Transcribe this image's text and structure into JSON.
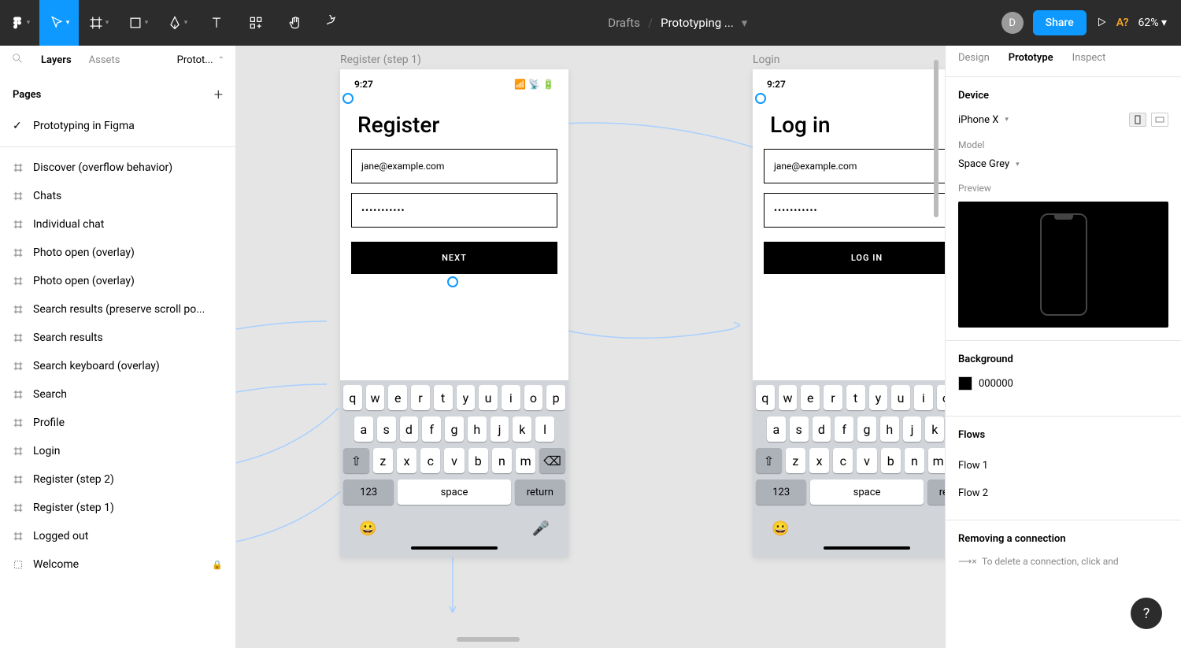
{
  "toolbar": {
    "breadcrumb_root": "Drafts",
    "breadcrumb_file": "Prototyping ...",
    "avatar_initial": "D",
    "share_label": "Share",
    "a11y_label": "A?",
    "zoom_label": "62%"
  },
  "left_panel": {
    "tab_layers": "Layers",
    "tab_assets": "Assets",
    "page_selector": "Protot...",
    "pages_header": "Pages",
    "page_name": "Prototyping in Figma",
    "layers": [
      "Discover (overflow behavior)",
      "Chats",
      "Individual chat",
      "Photo open (overlay)",
      "Photo open (overlay)",
      "Search results (preserve scroll po...",
      "Search results",
      "Search keyboard (overlay)",
      "Search",
      "Profile",
      "Login",
      "Register (step 2)",
      "Register (step 1)",
      "Logged out"
    ],
    "welcome_layer": "Welcome"
  },
  "canvas": {
    "frame1_label": "Register (step 1)",
    "frame2_label": "Login",
    "status_time": "9:27",
    "register_title": "Register",
    "login_title": "Log in",
    "email_placeholder": "jane@example.com",
    "password_dots": "•••••••••••",
    "next_button": "NEXT",
    "login_button": "LOG IN",
    "keyboard": {
      "row1": [
        "q",
        "w",
        "e",
        "r",
        "t",
        "y",
        "u",
        "i",
        "o",
        "p"
      ],
      "row2": [
        "a",
        "s",
        "d",
        "f",
        "g",
        "h",
        "j",
        "k",
        "l"
      ],
      "row3": [
        "z",
        "x",
        "c",
        "v",
        "b",
        "n",
        "m"
      ],
      "num": "123",
      "space": "space",
      "return": "return"
    }
  },
  "right_panel": {
    "tab_design": "Design",
    "tab_prototype": "Prototype",
    "tab_inspect": "Inspect",
    "device_label": "Device",
    "device_value": "iPhone X",
    "model_label": "Model",
    "model_value": "Space Grey",
    "preview_label": "Preview",
    "background_label": "Background",
    "background_value": "000000",
    "flows_label": "Flows",
    "flow1": "Flow 1",
    "flow2": "Flow 2",
    "tip_title": "Removing a connection",
    "tip_text": "To delete a connection, click and"
  }
}
